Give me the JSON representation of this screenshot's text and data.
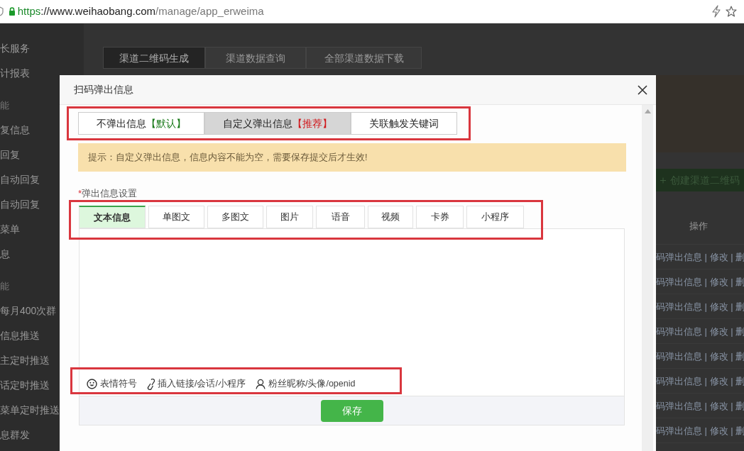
{
  "browser": {
    "url_scheme": "https",
    "url_separator": "://",
    "url_host": "www.weihaobang.com",
    "url_path": "/manage/app_erweima"
  },
  "sidebar": {
    "items": [
      {
        "label": "长服务",
        "kind": "item"
      },
      {
        "label": "计报表",
        "kind": "item"
      },
      {
        "label": "能",
        "kind": "section"
      },
      {
        "label": "复信息",
        "kind": "item"
      },
      {
        "label": "回复",
        "kind": "item"
      },
      {
        "label": "自动回复",
        "kind": "item"
      },
      {
        "label": "自动回复",
        "kind": "item"
      },
      {
        "label": "菜单",
        "kind": "item"
      },
      {
        "label": "息",
        "kind": "item"
      },
      {
        "label": "能",
        "kind": "section"
      },
      {
        "label": "每月400次群",
        "kind": "item"
      },
      {
        "label": "信息推送",
        "kind": "item"
      },
      {
        "label": "主定时推送",
        "kind": "item"
      },
      {
        "label": "话定时推送",
        "kind": "item"
      },
      {
        "label": "菜单定时推送",
        "kind": "item"
      },
      {
        "label": "息群发",
        "kind": "item"
      }
    ]
  },
  "page": {
    "tabs": [
      {
        "label": "渠道二维码生成",
        "selected": true
      },
      {
        "label": "渠道数据查询",
        "selected": false
      },
      {
        "label": "全部渠道数据下载",
        "selected": false
      }
    ],
    "create_button": "创建渠道二维码",
    "table": {
      "column_header": "操作",
      "rows": [
        {
          "actions": "码弹出信息 | 修改 | 删"
        },
        {
          "actions": "码弹出信息 | 修改 | 删"
        },
        {
          "actions": "码弹出信息 | 修改 | 删"
        },
        {
          "actions": "码弹出信息 | 修改 | 删"
        },
        {
          "actions": "码弹出信息 | 修改 | 删"
        },
        {
          "actions": "码弹出信息 | 修改 | 删"
        },
        {
          "actions": "码弹出信息 | 修改 | 删"
        },
        {
          "actions": "码弹出信息 | 修改 | 删"
        }
      ]
    }
  },
  "modal": {
    "title": "扫码弹出信息",
    "modes": [
      {
        "label": "不弹出信息",
        "tag": "【默认】",
        "color": "#1a7a1a",
        "selected": false
      },
      {
        "label": "自定义弹出信息",
        "tag": "【推荐】",
        "color": "#d0181c",
        "selected": true
      },
      {
        "label": "关联触发关键词",
        "selected": false
      }
    ],
    "notice": "提示：自定义弹出信息，信息内容不能为空，需要保存提交后才生效!",
    "section_label": "弹出信息设置",
    "required_mark": "*",
    "content_tabs": [
      {
        "label": "文本信息",
        "selected": true
      },
      {
        "label": "单图文",
        "selected": false
      },
      {
        "label": "多图文",
        "selected": false
      },
      {
        "label": "图片",
        "selected": false
      },
      {
        "label": "语音",
        "selected": false
      },
      {
        "label": "视频",
        "selected": false
      },
      {
        "label": "卡券",
        "selected": false
      },
      {
        "label": "小程序",
        "selected": false
      }
    ],
    "toolbar": [
      {
        "label": "表情符号",
        "kind": "emoji"
      },
      {
        "label": "插入链接/会话/小程序",
        "kind": "link"
      },
      {
        "label": "粉丝昵称/头像/openid",
        "kind": "user"
      }
    ],
    "save_button": "保存"
  }
}
